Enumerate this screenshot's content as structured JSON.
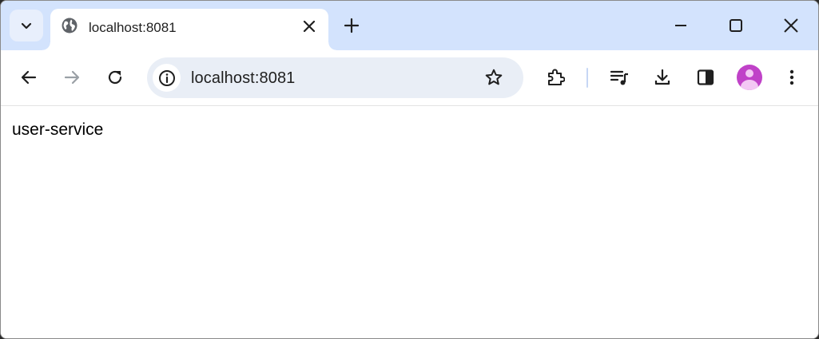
{
  "tab": {
    "title": "localhost:8081",
    "favicon": "globe-icon"
  },
  "omnibox": {
    "url": "localhost:8081",
    "site_info_icon": "info-icon",
    "bookmark_icon": "star-icon"
  },
  "toolbar": {
    "icons": [
      "back-icon",
      "forward-icon",
      "reload-icon",
      "extensions-icon",
      "reading-list-icon",
      "download-icon",
      "side-panel-icon",
      "avatar",
      "more-vert-icon"
    ]
  },
  "window_controls": [
    "minimize-icon",
    "maximize-icon",
    "close-icon"
  ],
  "page": {
    "text": "user-service"
  },
  "colors": {
    "tabstrip_bg": "#d3e3fd",
    "omnibox_bg": "#e9eef6",
    "avatar": "#c042c8",
    "icon": "#474747"
  }
}
